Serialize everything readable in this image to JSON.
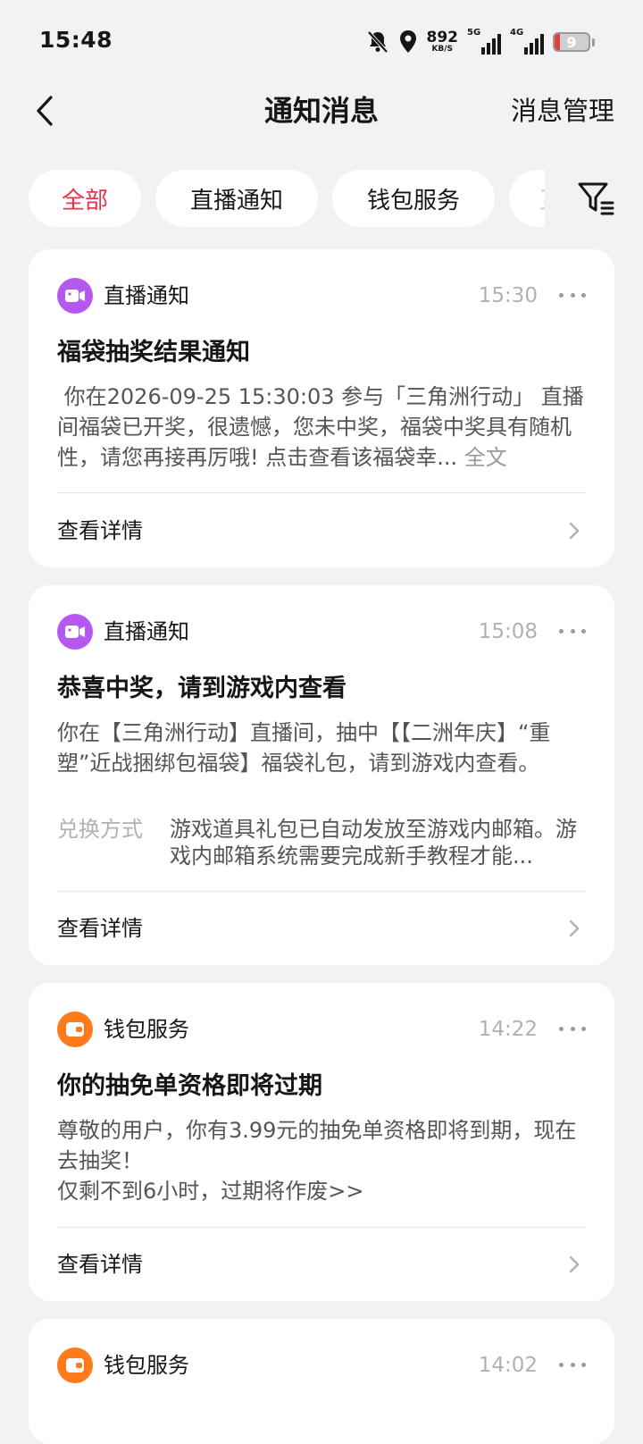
{
  "status_bar": {
    "time": "15:48",
    "net_speed_value": "892",
    "net_speed_unit": "KB/S",
    "sim1_label": "5G",
    "sim2_label": "4G",
    "battery": "9"
  },
  "nav": {
    "title": "通知消息",
    "manage_label": "消息管理"
  },
  "filters": {
    "chips": [
      {
        "label": "全部",
        "active": true
      },
      {
        "label": "直播通知",
        "active": false
      },
      {
        "label": "钱包服务",
        "active": false
      },
      {
        "label": "互",
        "active": false
      }
    ]
  },
  "colors": {
    "accent_red": "#e8334a",
    "live_purple": "#b458f0",
    "wallet_orange": "#ff7a1a"
  },
  "cards": [
    {
      "source": "直播通知",
      "icon": "video-camera-icon",
      "time": "15:30",
      "title": "福袋抽奖结果通知",
      "body": " 你在2026-09-25 15:30:03 参与「三角洲行动」 直播间福袋已开奖，很遗憾，您未中奖，福袋中奖具有随机性，请您再接再厉哦! 点击查看该福袋幸...",
      "full_text_label": "全文",
      "detail_label": "查看详情"
    },
    {
      "source": "直播通知",
      "icon": "video-camera-icon",
      "time": "15:08",
      "title": "恭喜中奖，请到游戏内查看",
      "body": "你在【三角洲行动】直播间，抽中【【二洲年庆】“重塑”近战捆绑包福袋】福袋礼包，请到游戏内查看。",
      "kv_key": "兑换方式",
      "kv_value": "游戏道具礼包已自动发放至游戏内邮箱。游戏内邮箱系统需要完成新手教程才能...",
      "detail_label": "查看详情"
    },
    {
      "source": "钱包服务",
      "icon": "wallet-icon",
      "time": "14:22",
      "title": "你的抽免单资格即将过期",
      "body_line1": "尊敬的用户，你有3.99元的抽免单资格即将到期，现在去抽奖！",
      "body_line2": "仅剩不到6小时，过期将作废>>",
      "detail_label": "查看详情"
    },
    {
      "source": "钱包服务",
      "icon": "wallet-icon",
      "time": "14:02"
    }
  ]
}
